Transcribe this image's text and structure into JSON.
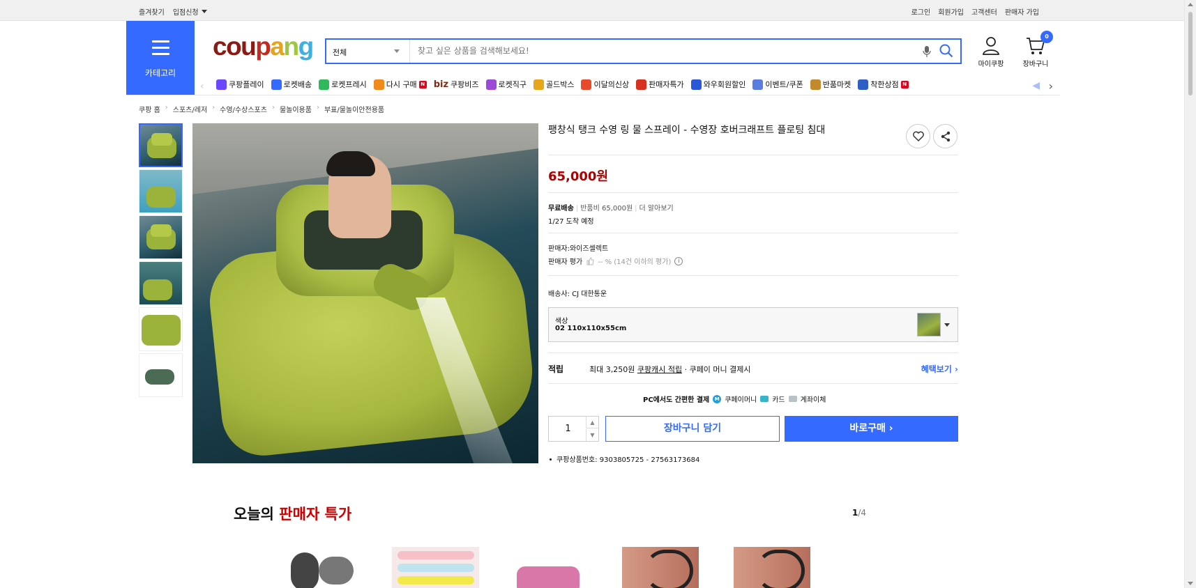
{
  "topbar": {
    "bookmark": "즐겨찾기",
    "partner": "입점신청",
    "login": "로그인",
    "signup": "회원가입",
    "support": "고객센터",
    "seller_signup": "판매자 가입"
  },
  "header": {
    "category_label": "카테고리",
    "logo": [
      "cou",
      "p",
      "a",
      "n",
      "g"
    ],
    "search_scope": "전체",
    "search_placeholder": "찾고 싶은 상품을 검색해보세요!",
    "my_coupang": "마이쿠팡",
    "cart": "장바구니",
    "cart_count": "0"
  },
  "catmenu": [
    {
      "label": "쿠팡플레이",
      "icon": "play-icon",
      "color": "#6b47ff"
    },
    {
      "label": "로켓배송",
      "icon": "rocket-icon",
      "color": "#346aff"
    },
    {
      "label": "로켓프레시",
      "icon": "rocket-fresh-icon",
      "color": "#2fb85c"
    },
    {
      "label": "다시 구매",
      "icon": "rebuy-icon",
      "color": "#f08a1a",
      "badge": "N"
    },
    {
      "label": "쿠팡비즈",
      "icon": "biz-icon",
      "biz": "biz"
    },
    {
      "label": "로켓직구",
      "icon": "global-icon",
      "color": "#9b4bd6"
    },
    {
      "label": "골드박스",
      "icon": "goldbox-icon",
      "color": "#e6a71b"
    },
    {
      "label": "이달의신상",
      "icon": "bag-icon",
      "color": "#e94a2a"
    },
    {
      "label": "판매자특가",
      "icon": "percent-icon",
      "color": "#d6321f"
    },
    {
      "label": "와우회원할인",
      "icon": "wow-icon",
      "color": "#2a58d6"
    },
    {
      "label": "이벤트/쿠폰",
      "icon": "coupon-icon",
      "color": "#5a7ee0"
    },
    {
      "label": "반품마켓",
      "icon": "return-market-icon",
      "color": "#c28a2c"
    },
    {
      "label": "착한상점",
      "icon": "good-store-icon",
      "color": "#2d5fc4",
      "badge": "N"
    }
  ],
  "breadcrumb": [
    "쿠팡 홈",
    "스포츠/레저",
    "수영/수상스포츠",
    "물놀이용품",
    "부표/물놀이안전용품"
  ],
  "product": {
    "title": "팽창식 탱크 수영 링 물 스프레이 - 수영장 호버크래프트 플로팅 침대",
    "price": "65,000원",
    "free_shipping": "무료배송",
    "return_fee": "반품비 65,000원",
    "learn_more": "더 알아보기",
    "arrival": "1/27 도착 예정",
    "seller": "판매자:와이즈셀렉트",
    "seller_rating_label": "판매자 평가",
    "seller_rating_value": "-- % (14건 이하의 평가)",
    "courier": "배송사:  CJ 대한통운",
    "option_label": "색상",
    "option_value": "02 110x110x55cm",
    "reward_head": "적립",
    "reward_max": "최대 3,250원",
    "reward_link": "쿠팡캐시 적립",
    "reward_cond": "· 쿠페이 머니 결제시",
    "reward_more": "혜택보기 ›",
    "pay_text": "PC에서도 간편한 결제",
    "pay_money": "쿠페이머니",
    "pay_card": "카드",
    "pay_bank": "계좌이체",
    "quantity": "1",
    "add_to_cart": "장바구니 담기",
    "buy_now": "바로구매 ›",
    "product_id": "쿠팡상품번호: 9303805725 - 27563173684"
  },
  "deals": {
    "title_prefix": "오늘의",
    "title_highlight": "판매자 특가",
    "page_current": "1",
    "page_total": "/4"
  }
}
